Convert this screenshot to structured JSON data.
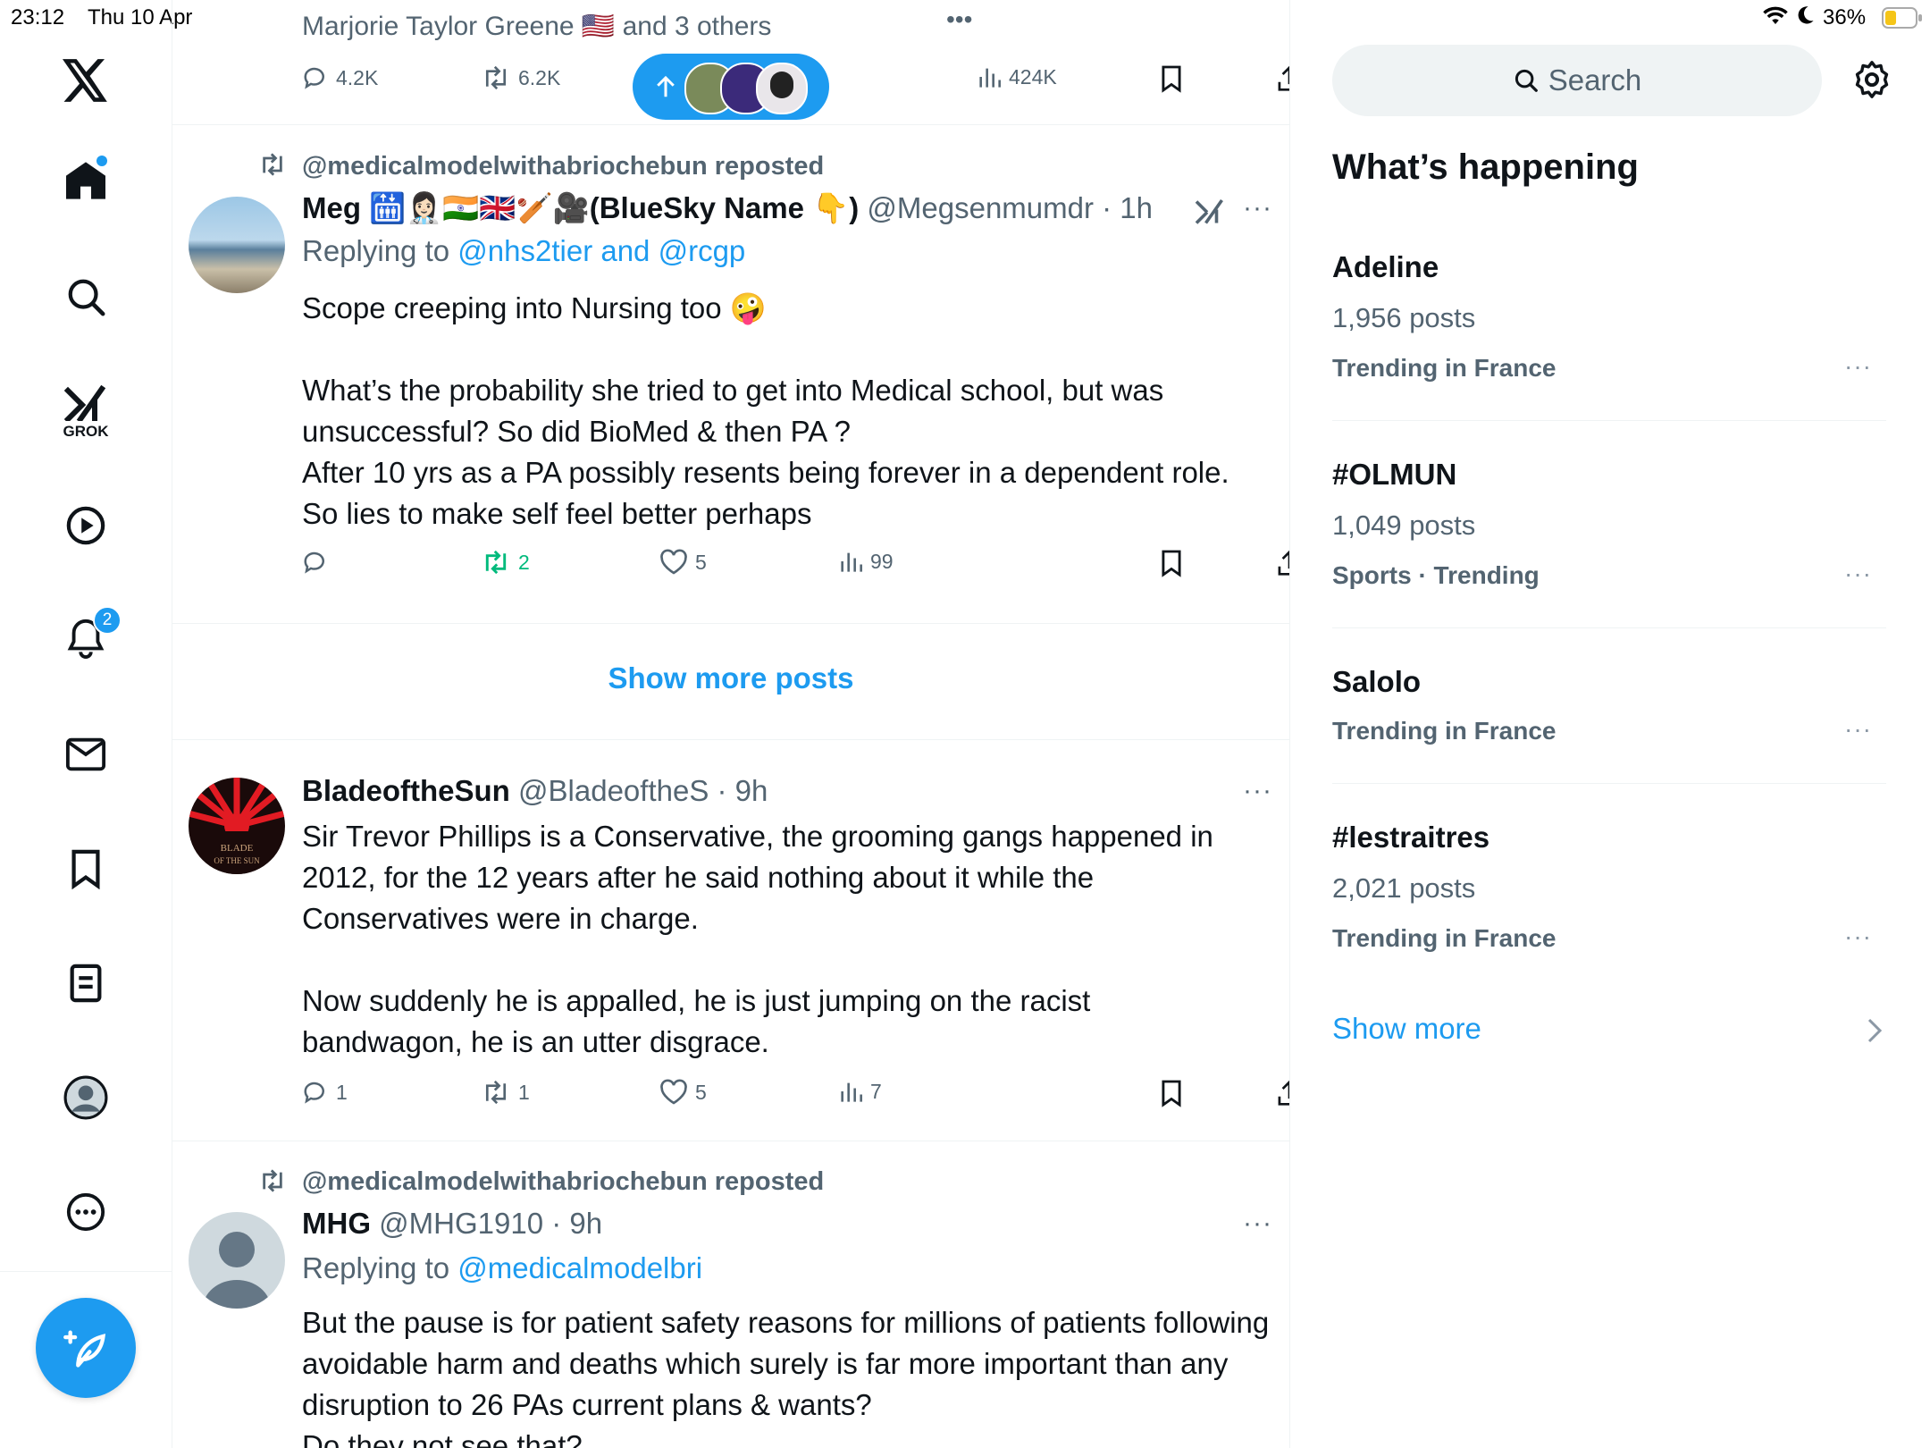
{
  "status_bar": {
    "time": "23:12",
    "date": "Thu 10 Apr",
    "battery": "36%"
  },
  "nav": {
    "grok_label": "GROK",
    "notifications_count": "2",
    "accent_color": "#1d9bf0"
  },
  "feed": {
    "top_post": {
      "liked_by": "Marjorie Taylor Greene 🇺🇸 and 3 others",
      "replies": "4.2K",
      "reposts": "6.2K",
      "views": "424K"
    },
    "post1": {
      "repost_label": "@medicalmodelwithabriochebun reposted",
      "author": "Meg 🛗👩🏻‍⚕️🇮🇳🇬🇧🏏🎥(BlueSky Name 👇)",
      "handle_time": "@Megsenmumdr · 1h",
      "replying_prefix": "Replying to",
      "replying_to": "@nhs2tier and @rcgp",
      "text": "Scope creeping into Nursing too 🤪\n\nWhat’s the probability she tried to get into Medical school, but was unsuccessful? So did BioMed & then PA ?\nAfter 10 yrs as a PA possibly resents being forever in a dependent role. So lies to make self feel better perhaps",
      "replies": "",
      "reposts": "2",
      "likes": "5",
      "views": "99"
    },
    "show_more_posts": "Show more posts",
    "post2": {
      "author": "BladeoftheSun",
      "handle_time": "@BladeoftheS · 9h",
      "avatar_text": "BLADE OF THE SUN",
      "text": "Sir Trevor Phillips is a Conservative, the grooming gangs happened in 2012, for the 12 years after he said nothing about it while the Conservatives were in charge.\n\nNow suddenly he is appalled, he is just jumping on the racist bandwagon, he is an utter disgrace.",
      "replies": "1",
      "reposts": "1",
      "likes": "5",
      "views": "7"
    },
    "post3": {
      "repost_label": "@medicalmodelwithabriochebun reposted",
      "author": "MHG",
      "handle_time": "@MHG1910 · 9h",
      "replying_prefix": "Replying to",
      "replying_to": "@medicalmodelbri",
      "text": "But the pause is for patient safety reasons for millions of patients following avoidable harm and deaths which surely is far more important than any disruption to 26 PAs current plans & wants?\nDo they not see that?"
    }
  },
  "sidebar": {
    "search_placeholder": "Search",
    "heading": "What’s happening",
    "trends": [
      {
        "title": "Adeline",
        "posts": "1,956 posts",
        "context": "Trending in France"
      },
      {
        "title": "#OLMUN",
        "posts": "1,049 posts",
        "context": "Sports · Trending"
      },
      {
        "title": "Salolo",
        "posts": "",
        "context": "Trending in France"
      },
      {
        "title": "#lestraitres",
        "posts": "2,021 posts",
        "context": "Trending in France"
      }
    ],
    "show_more": "Show more"
  }
}
